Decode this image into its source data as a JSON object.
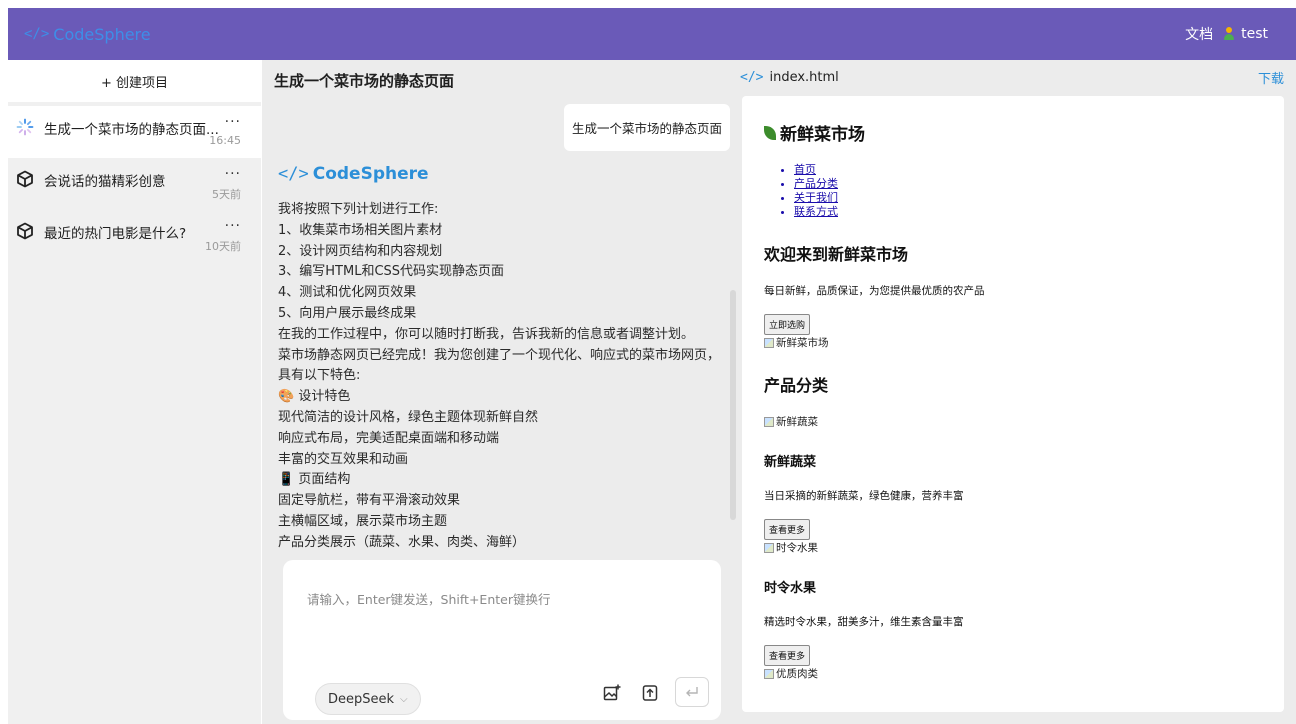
{
  "header": {
    "brand": "CodeSphere",
    "brand_icon": "code-icon",
    "docs_label": "文档",
    "user_name": "test",
    "bar_color": "#6a5ab8"
  },
  "sidebar": {
    "create_label": "+ 创建项目",
    "projects": [
      {
        "title": "生成一个菜市场的静态页面...",
        "menu": "···",
        "time": "16:45",
        "icon": "spinner-icon",
        "active": true
      },
      {
        "title": "会说话的猫精彩创意",
        "menu": "···",
        "time": "5天前",
        "icon": "cube-icon",
        "active": false
      },
      {
        "title": "最近的热门电影是什么?",
        "menu": "···",
        "time": "10天前",
        "icon": "cube-icon",
        "active": false
      }
    ]
  },
  "chat": {
    "title": "生成一个菜市场的静态页面",
    "user_message": "生成一个菜市场的静态页面",
    "assistant_name": "CodeSphere",
    "lines": [
      "我将按照下列计划进行工作:",
      "1、收集菜市场相关图片素材",
      "2、设计网页结构和内容规划",
      "3、编写HTML和CSS代码实现静态页面",
      "4、测试和优化网页效果",
      "5、向用户展示最终成果",
      "在我的工作过程中，你可以随时打断我，告诉我新的信息或者调整计划。",
      "菜市场静态网页已经完成！我为您创建了一个现代化、响应式的菜市场网页，具有以下特色:",
      "🎨 设计特色",
      "现代简洁的设计风格，绿色主题体现新鲜自然",
      "响应式布局，完美适配桌面端和移动端",
      "丰富的交互效果和动画",
      "📱 页面结构",
      "固定导航栏，带有平滑滚动效果",
      "主横幅区域，展示菜市场主题",
      "产品分类展示（蔬菜、水果、肉类、海鲜）"
    ],
    "input_placeholder": "请输入，Enter键发送，Shift+Enter键换行",
    "model": "DeepSeek"
  },
  "preview": {
    "filename": "index.html",
    "download_label": "下载",
    "site_title": "新鲜菜市场",
    "nav": [
      "首页",
      "产品分类",
      "关于我们",
      "联系方式"
    ],
    "hero_heading": "欢迎来到新鲜菜市场",
    "hero_text": "每日新鲜，品质保证，为您提供最优质的农产品",
    "hero_button": "立即选购",
    "hero_img_alt": "新鲜菜市场",
    "category_heading": "产品分类",
    "veg_img_alt": "新鲜蔬菜",
    "veg_title": "新鲜蔬菜",
    "veg_text": "当日采摘的新鲜蔬菜，绿色健康，营养丰富",
    "veg_button": "查看更多",
    "fruit_img_alt": "时令水果",
    "fruit_title": "时令水果",
    "fruit_text": "精选时令水果，甜美多汁，维生素含量丰富",
    "fruit_button": "查看更多",
    "meat_img_alt": "优质肉类"
  }
}
